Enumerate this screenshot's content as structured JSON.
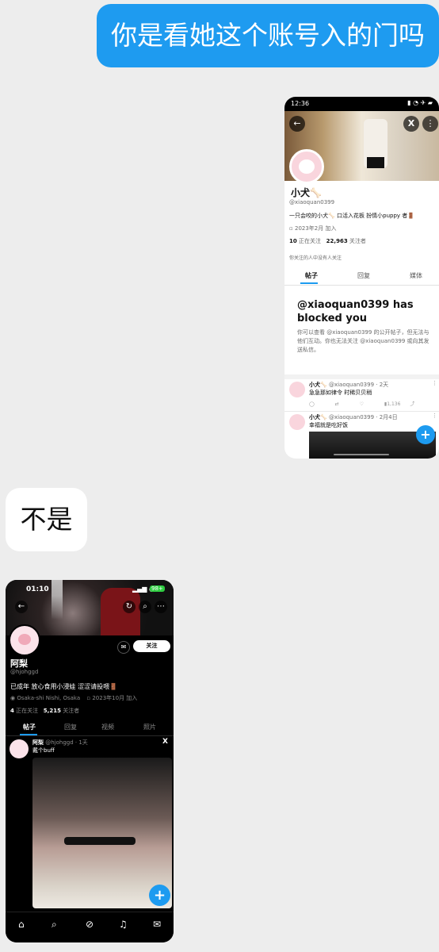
{
  "chat": {
    "my_message": "你是看她这个账号入的门吗",
    "their_reply": "不是"
  },
  "shot1": {
    "status_time": "12:36",
    "display_name": "小犬🦴",
    "handle": "@xiaoquan0399",
    "bio": "一只会咬的小犬🦴 口活入花板 扮情小puppy 者🚪",
    "joined": "2023年2月 加入",
    "following_count": "10",
    "following_label": "正在关注",
    "followers_count": "22,963",
    "followers_label": "关注者",
    "mutual_note": "你关注的人中没有人关注",
    "tabs": [
      "帖子",
      "回复",
      "媒体"
    ],
    "blocked_title": "@xiaoquan0399 has blocked you",
    "blocked_desc": "你可以查看 @xiaoquan0399 的公开帖子，但无法与他们互动。你也无法关注 @xiaoquan0399 或向其发送私信。",
    "posts": [
      {
        "name": "小犬🦴",
        "meta": "@xiaoquan0399 · 2天",
        "text": "急急那如律令 时稀贝贝稍",
        "views": "1,136"
      },
      {
        "name": "小犬🦴",
        "meta": "@xiaoquan0399 · 2月4日",
        "text": "幸福就是吃好饭"
      }
    ],
    "fab_label": "+"
  },
  "shot2": {
    "status_time": "01:10",
    "battery": "98+",
    "follow_button": "关注",
    "display_name": "阿梨",
    "handle": "@hjohggd",
    "bio": "已成年 放心食用小浸娃 涩涩请投喂🚪",
    "location": "Osaka-shi Nishi, Osaka",
    "joined": "2023年10月 加入",
    "following_count": "4",
    "following_label": "正在关注",
    "followers_count": "5,215",
    "followers_label": "关注者",
    "tabs": [
      "帖子",
      "回复",
      "视频",
      "照片"
    ],
    "post": {
      "name": "阿梨",
      "meta": "@hjohggd · 1天",
      "text": "戴个buff"
    },
    "fab_label": "+"
  }
}
